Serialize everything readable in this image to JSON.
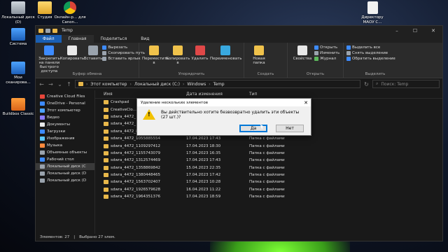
{
  "desktop": {
    "icons": [
      {
        "label": "Локальный диск (D)",
        "icon": "drive-icon"
      },
      {
        "label": "Студия",
        "icon": "folder-icon"
      },
      {
        "label": "Онлайн-р... для Canon...",
        "icon": "chrome-icon"
      },
      {
        "label": "Система",
        "icon": "pc-icon"
      },
      {
        "label": "Мои сканирова...",
        "icon": "pc-icon"
      },
      {
        "label": "Buildbox Classic",
        "icon": "buildbox-icon"
      },
      {
        "label": "Директору МАОУ С...",
        "icon": "document-icon"
      }
    ]
  },
  "window": {
    "title": "Temp",
    "controls": [
      "–",
      "☐",
      "✕"
    ],
    "tabs": [
      "Файл",
      "Главная",
      "Поделиться",
      "Вид"
    ],
    "ribbon": {
      "clipboard": {
        "pin": "Закрепить на панели быстрого доступа",
        "copy": "Копировать",
        "paste": "Вставить",
        "cut": "Вырезать",
        "copy_path": "Скопировать путь",
        "paste_shortcut": "Вставить ярлык",
        "group": "Буфер обмена"
      },
      "organize": {
        "move": "Переместить в",
        "copy_to": "Копировать в",
        "delete": "Удалить",
        "rename": "Переименовать",
        "group": "Упорядочить"
      },
      "create": {
        "new_folder": "Новая папка",
        "group": "Создать"
      },
      "open": {
        "properties": "Свойства",
        "open": "Открыть",
        "edit": "Изменить",
        "history": "Журнал",
        "group": "Открыть"
      },
      "select": {
        "select_all": "Выделить все",
        "select_none": "Снять выделение",
        "invert": "Обратить выделение",
        "group": "Выделить"
      }
    },
    "address": [
      "Этот компьютер",
      "Локальный диск (C:)",
      "Windows",
      "Temp"
    ],
    "search_placeholder": "Поиск: Temp",
    "nav": [
      {
        "label": "Creative Cloud Files",
        "color": "#e8463a"
      },
      {
        "label": "OneDrive - Personal",
        "color": "#3d8bff"
      },
      {
        "label": "Этот компьютер",
        "color": "#4da3ff"
      },
      {
        "label": "Видео",
        "color": "#8a7cff"
      },
      {
        "label": "Документы",
        "color": "#e8e8e8"
      },
      {
        "label": "Загрузки",
        "color": "#3d8bff"
      },
      {
        "label": "Изображения",
        "color": "#5cc8ff"
      },
      {
        "label": "Музыка",
        "color": "#ff8a3d"
      },
      {
        "label": "Объемные объекты",
        "color": "#9aa3ad"
      },
      {
        "label": "Рабочий стол",
        "color": "#3d8bff"
      },
      {
        "label": "Локальный диск (C",
        "color": "#9aa3ad"
      },
      {
        "label": "Локальный диск (D",
        "color": "#9aa3ad"
      },
      {
        "label": "Локальный диск (D",
        "color": "#9aa3ad"
      }
    ],
    "columns": [
      "Имя",
      "Дата изменения",
      "Тип"
    ],
    "files": [
      {
        "name": "Crashpad",
        "date": "",
        "type": ""
      },
      {
        "name": "CreativeClo...",
        "date": "",
        "type": ""
      },
      {
        "name": "sdwra_4472_",
        "date": "",
        "type": ""
      },
      {
        "name": "sdwra_4472_",
        "date": "",
        "type": ""
      },
      {
        "name": "sdwra_4472_87540428",
        "date": "15.04.2023 22:35",
        "type": "Папка с файлами"
      },
      {
        "name": "sdwra_4472_1055885554",
        "date": "17.04.2023 17:43",
        "type": "Папка с файлами"
      },
      {
        "name": "sdwra_4472_1109297412",
        "date": "17.04.2023 18:30",
        "type": "Папка с файлами"
      },
      {
        "name": "sdwra_4472_1155743079",
        "date": "17.04.2023 16:35",
        "type": "Папка с файлами"
      },
      {
        "name": "sdwra_4472_1312574469",
        "date": "17.04.2023 17:43",
        "type": "Папка с файлами"
      },
      {
        "name": "sdwra_4472_1358869842",
        "date": "15.04.2023 22:35",
        "type": "Папка с файлами"
      },
      {
        "name": "sdwra_4472_1380448465",
        "date": "17.04.2023 17:42",
        "type": "Папка с файлами"
      },
      {
        "name": "sdwra_4472_1563702407",
        "date": "17.04.2023 10:28",
        "type": "Папка с файлами"
      },
      {
        "name": "sdwra_4472_1926579628",
        "date": "16.04.2023 11:22",
        "type": "Папка с файлами"
      },
      {
        "name": "sdwra_4472_1964351376",
        "date": "17.04.2023 18:59",
        "type": "Папка с файлами"
      }
    ],
    "status": [
      "Элементов: 27",
      "Выбрано 27 элем."
    ]
  },
  "dialog": {
    "title": "Удаление нескольких элементов",
    "message": "Вы действительно хотите безвозвратно удалить эти объекты (27 шт.)?",
    "yes": "Да",
    "no": "Нет",
    "close": "✕"
  },
  "colors": {
    "accent": "#1a5fb4",
    "folder": "#e8b74a",
    "warning": "#f2c200"
  }
}
